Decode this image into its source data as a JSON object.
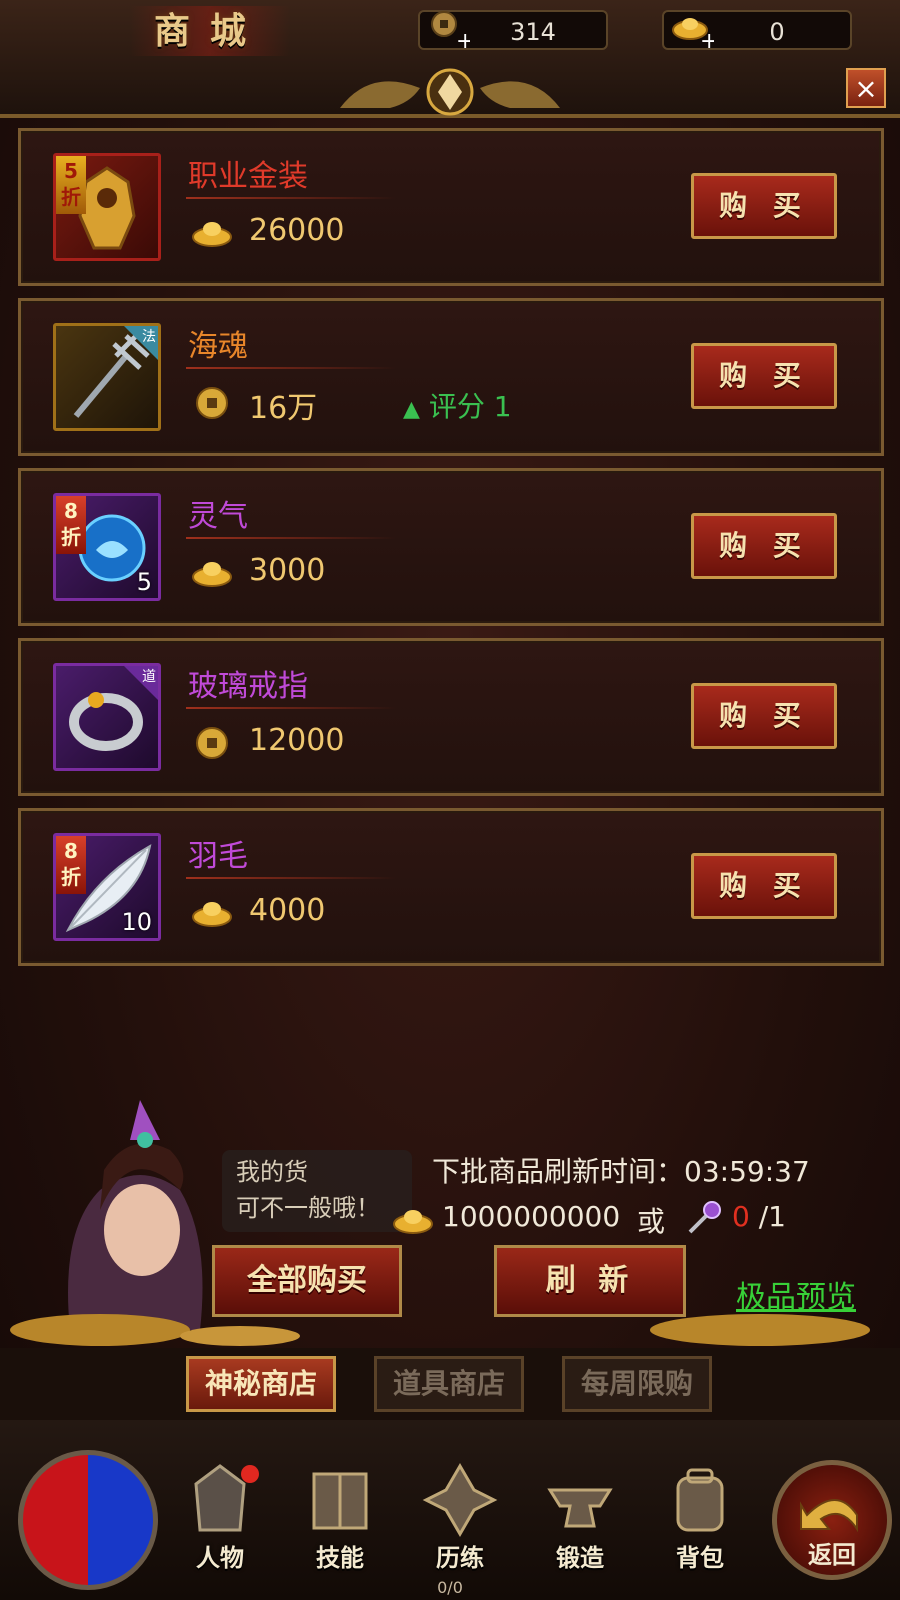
{
  "header": {
    "title": "商城",
    "currencies": [
      {
        "icon": "copper-coin-add-icon",
        "value": "314"
      },
      {
        "icon": "gold-ingot-add-icon",
        "value": "0"
      }
    ]
  },
  "items": [
    {
      "name": "职业金装",
      "name_color": "#e03a2a",
      "badge": "5\n折",
      "badge_style": "gold",
      "icon": "golden-armor-icon",
      "quality": "red",
      "price_icon": "gold-ingot-icon",
      "price": "26000",
      "buy_label": "购 买"
    },
    {
      "name": "海魂",
      "name_color": "#e8862a",
      "corner": "法",
      "icon": "trident-icon",
      "quality": "gold",
      "price_icon": "coin-icon",
      "price": "16万",
      "score_label": "评分 1",
      "buy_label": "购 买"
    },
    {
      "name": "灵气",
      "name_color": "#c04ad8",
      "badge": "8\n折",
      "badge_style": "red",
      "icon": "spirit-orb-icon",
      "quality": "purple",
      "count": "5",
      "price_icon": "gold-ingot-icon",
      "price": "3000",
      "buy_label": "购 买"
    },
    {
      "name": "玻璃戒指",
      "name_color": "#c04ad8",
      "corner": "道",
      "icon": "ring-icon",
      "quality": "purple",
      "price_icon": "coin-icon",
      "price": "12000",
      "buy_label": "购 买"
    },
    {
      "name": "羽毛",
      "name_color": "#c04ad8",
      "badge": "8\n折",
      "badge_style": "red",
      "icon": "feather-icon",
      "quality": "purple",
      "count": "10",
      "price_icon": "gold-ingot-icon",
      "price": "4000",
      "buy_label": "购 买"
    }
  ],
  "merchant": {
    "bubble_line1": "我的货",
    "bubble_line2": "可不一般哦！",
    "refresh_label": "下批商品刷新时间：03:59:37",
    "refresh_cost": "1000000000",
    "or_label": "或",
    "key_current": "0",
    "key_total": " /1",
    "buy_all_label": "全部购买",
    "refresh_button_label": "刷  新",
    "preview_label": "极品预览"
  },
  "tabs": [
    {
      "label": "神秘商店",
      "active": true
    },
    {
      "label": "道具商店",
      "active": false
    },
    {
      "label": "每周限购",
      "active": false
    }
  ],
  "nav": {
    "items": [
      {
        "label": "人物",
        "icon": "character-helmet-icon"
      },
      {
        "label": "技能",
        "icon": "skill-book-icon"
      },
      {
        "label": "历练",
        "icon": "training-emblem-icon"
      },
      {
        "label": "锻造",
        "icon": "anvil-icon"
      },
      {
        "label": "背包",
        "icon": "backpack-icon"
      }
    ],
    "back_label": "返回",
    "page_indicator": "0/0"
  },
  "colors": {
    "accent_gold": "#c89848",
    "button_red": "#9a2818",
    "link_green": "#38d038",
    "score_green": "#3ac050"
  }
}
